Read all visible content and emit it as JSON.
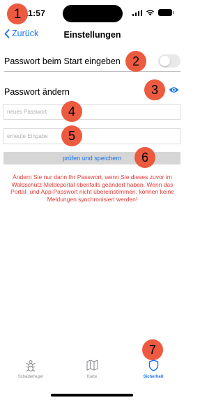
{
  "status_bar": {
    "time": "11:57"
  },
  "nav": {
    "back_label": "Zurück",
    "title": "Einstellungen"
  },
  "settings": {
    "password_on_start": {
      "label": "Passwort beim Start eingeben",
      "enabled": false
    },
    "change_password": {
      "label": "Passwort ändern",
      "new_password_placeholder": "neues Passwort",
      "repeat_placeholder": "erneute Eingabe",
      "new_password_value": "",
      "repeat_value": "",
      "save_button_label": "prüfen und speichern"
    },
    "warning_text": "Ändern Sie nur dann Ihr Passwort, wenn Sie dieses zuvor im Waldschutz-Meldeportal ebenfalls geändert haben. Wenn das Portal- und App-Passwort nicht übereinstimmen, können keine Meldungen synchronisiert werden!"
  },
  "markers": [
    "1",
    "2",
    "3",
    "4",
    "5",
    "6",
    "7"
  ],
  "tab_bar": {
    "tabs": [
      {
        "label": "Schaderreger",
        "icon": "bug-icon",
        "active": false
      },
      {
        "label": "Karte",
        "icon": "map-icon",
        "active": false
      },
      {
        "label": "Sicherheit",
        "icon": "shield-icon",
        "active": true
      }
    ]
  },
  "colors": {
    "accent": "#1a73e8",
    "warning": "#e53935",
    "marker": "#ec5a3f",
    "button_bg": "#d6d6d6",
    "inactive_tab": "#8e8e93"
  }
}
